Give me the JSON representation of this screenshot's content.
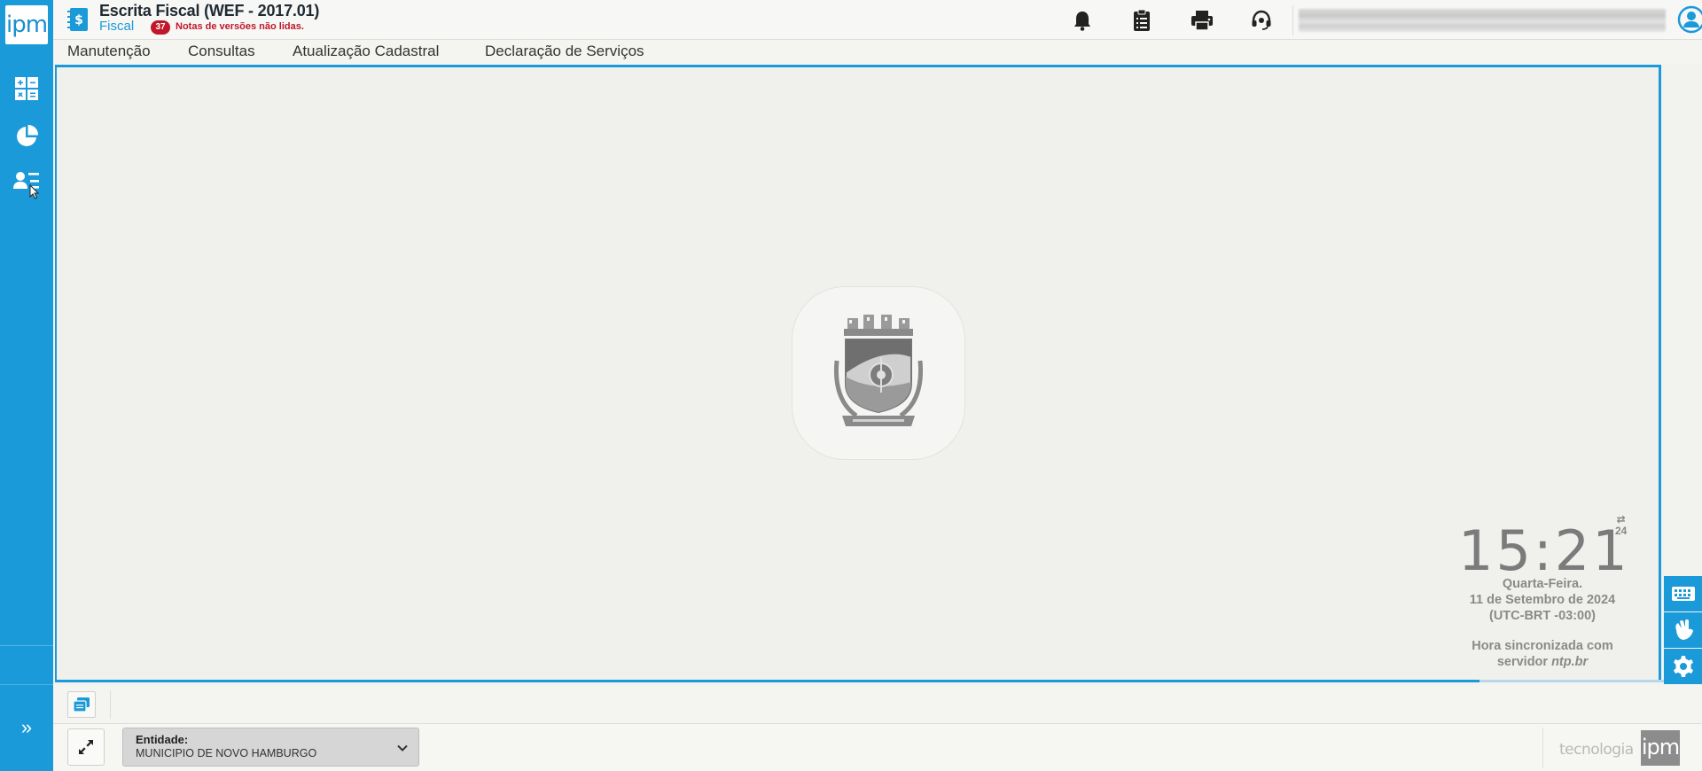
{
  "sidebar": {
    "logo_text": "ipm",
    "items": [
      {
        "name": "calculator-icon"
      },
      {
        "name": "pie-chart-icon"
      },
      {
        "name": "user-list-icon"
      }
    ],
    "expand_glyph": "»"
  },
  "header": {
    "title": "Escrita Fiscal (WEF - 2017.01)",
    "subtitle": "Fiscal",
    "notes_count": "37",
    "notes_text": "Notas de versões não lidas.",
    "icons": [
      "bell-icon",
      "clipboard-icon",
      "printer-icon",
      "headset-icon",
      "user-avatar-icon"
    ]
  },
  "menu": {
    "items": [
      "Manutenção",
      "Consultas",
      "Atualização Cadastral",
      "Declaração de Serviços"
    ]
  },
  "clock": {
    "time": "15:21",
    "format_label": "24",
    "weekday": "Quarta-Feira.",
    "date": "11 de Setembro de 2024",
    "timezone": "(UTC-BRT -03:00)",
    "sync_line1": "Hora sincronizada com",
    "sync_line2_prefix": "servidor ",
    "sync_server": "ntp.br"
  },
  "right_tools": [
    "keyboard-icon",
    "sign-language-icon",
    "settings-icon"
  ],
  "status": {
    "entity_label": "Entidade:",
    "entity_value": "MUNICIPIO DE NOVO HAMBURGO",
    "brand_text": "tecnologia",
    "brand_logo": "ipm"
  },
  "colors": {
    "primary": "#1a9ad9",
    "badge": "#c0182a"
  }
}
